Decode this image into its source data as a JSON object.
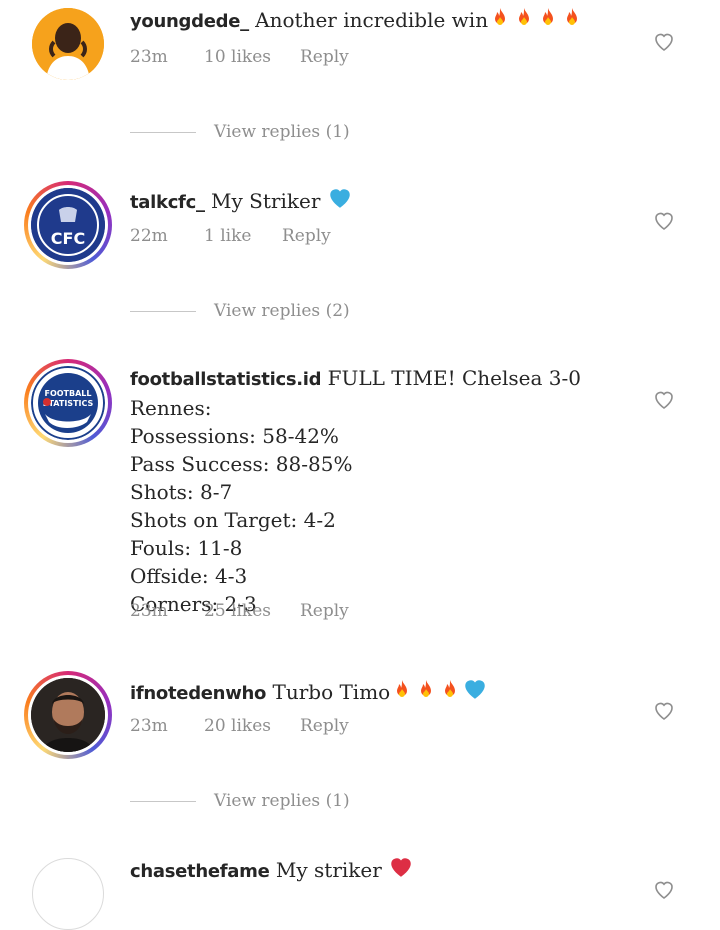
{
  "comments": [
    {
      "username": "youngdede_",
      "text": "Another incredible win",
      "emojis": [
        "fire",
        "fire",
        "fire",
        "fire"
      ],
      "time": "23m",
      "likes": "10 likes",
      "reply": "Reply",
      "view_replies": "View replies (1)"
    },
    {
      "username": "talkcfc_",
      "text": "My Striker",
      "emojis": [
        "blue-heart"
      ],
      "time": "22m",
      "likes": "1 like",
      "reply": "Reply",
      "view_replies": "View replies (2)",
      "avatar_text": "CFC"
    },
    {
      "username": "footballstatistics.id",
      "text": "FULL TIME! Chelsea 3-0 Rennes:",
      "extra_lines": [
        "Possessions: 58-42%",
        "Pass Success: 88-85%",
        "Shots: 8-7",
        "Shots on Target: 4-2",
        "Fouls: 11-8",
        "Offside: 4-3",
        "Corners: 2-3"
      ],
      "time": "23m",
      "likes": "25 likes",
      "reply": "Reply",
      "avatar_text_1": "FOOTBALL",
      "avatar_text_2": "STATISTICS"
    },
    {
      "username": "ifnotedenwho",
      "text": "Turbo Timo",
      "emojis": [
        "fire",
        "fire",
        "fire",
        "blue-heart"
      ],
      "time": "23m",
      "likes": "20 likes",
      "reply": "Reply",
      "view_replies": "View replies (1)"
    },
    {
      "username": "chasethefame",
      "text": "My striker",
      "emojis": [
        "red-heart"
      ]
    }
  ],
  "colors": {
    "fire": "#f4511e",
    "blue_heart": "#3aaee0",
    "red_heart": "#dd2e44",
    "meta": "#8e8e8e",
    "text": "#262626"
  }
}
